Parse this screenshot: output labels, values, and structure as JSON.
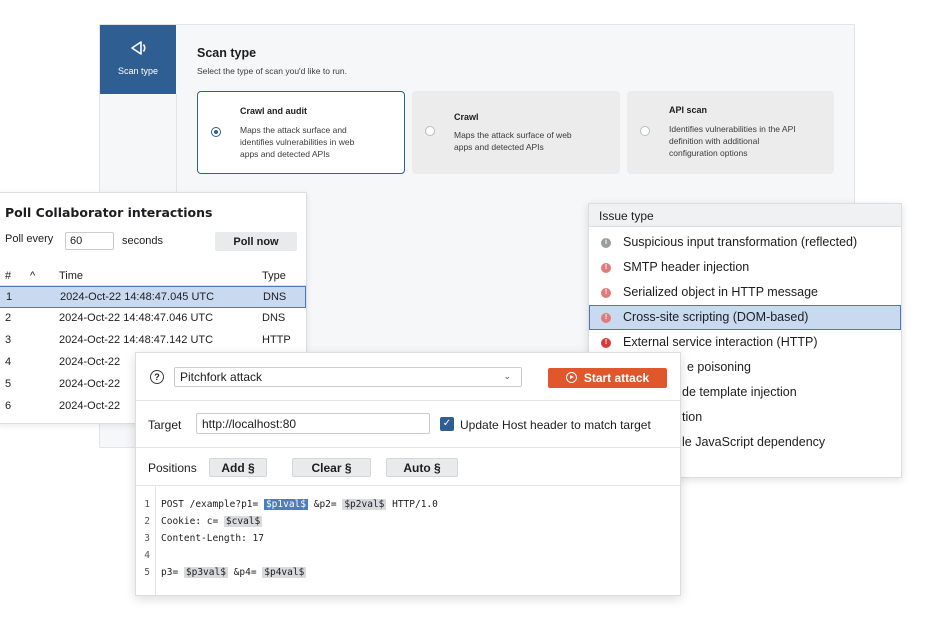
{
  "scan_panel": {
    "nav_label": "Scan type",
    "title": "Scan type",
    "subtitle": "Select the type of scan you'd like to run.",
    "options": [
      {
        "title": "Crawl and audit",
        "desc1": "Maps the attack surface and",
        "desc2": "identifies vulnerabilities in web",
        "desc3": "apps and detected APIs",
        "selected": true
      },
      {
        "title": "Crawl",
        "desc1": "Maps the attack surface of web",
        "desc2": "apps and detected APIs",
        "desc3": "",
        "selected": false
      },
      {
        "title": "API scan",
        "desc1": "Identifies vulnerabilities in the API",
        "desc2": "definition with additional",
        "desc3": "configuration options",
        "selected": false
      }
    ]
  },
  "poll": {
    "title": "Poll Collaborator interactions",
    "poll_every_label": "Poll every",
    "interval_value": "60",
    "seconds_label": "seconds",
    "poll_now_label": "Poll now",
    "headers": {
      "num": "#",
      "sort": "^",
      "time": "Time",
      "type": "Type"
    },
    "rows": [
      {
        "num": "1",
        "time": "2024-Oct-22 14:48:47.045 UTC",
        "type": "DNS"
      },
      {
        "num": "2",
        "time": "2024-Oct-22 14:48:47.046 UTC",
        "type": "DNS"
      },
      {
        "num": "3",
        "time": "2024-Oct-22 14:48:47.142 UTC",
        "type": "HTTP"
      },
      {
        "num": "4",
        "time": "2024-Oct-22",
        "type": ""
      },
      {
        "num": "5",
        "time": "2024-Oct-22",
        "type": ""
      },
      {
        "num": "6",
        "time": "2024-Oct-22",
        "type": ""
      }
    ]
  },
  "issues": {
    "header": "Issue type",
    "items": [
      {
        "label": "Suspicious input transformation (reflected)",
        "severity": "info",
        "color": "#9a9ca0",
        "glyph": "i"
      },
      {
        "label": "SMTP header injection",
        "severity": "high",
        "color": "#e07b7b",
        "glyph": "!"
      },
      {
        "label": "Serialized object in HTTP message",
        "severity": "high",
        "color": "#e07b7b",
        "glyph": "!"
      },
      {
        "label": "Cross-site scripting (DOM-based)",
        "severity": "high",
        "color": "#e07b7b",
        "glyph": "!"
      },
      {
        "label": "External service interaction (HTTP)",
        "severity": "high",
        "color": "#d83b3b",
        "glyph": "!"
      },
      {
        "label": "e poisoning",
        "severity": "",
        "color": "",
        "glyph": ""
      },
      {
        "label": "de template injection",
        "severity": "",
        "color": "",
        "glyph": ""
      },
      {
        "label": "tion",
        "severity": "",
        "color": "",
        "glyph": ""
      },
      {
        "label": "le JavaScript dependency",
        "severity": "",
        "color": "",
        "glyph": ""
      }
    ]
  },
  "intruder": {
    "help_glyph": "?",
    "attack_type": "Pitchfork attack",
    "start_label": "Start attack",
    "target_label": "Target",
    "target_value": "http://localhost:80",
    "update_host_label": "Update Host header to match target",
    "positions_label": "Positions",
    "add_label": "Add §",
    "clear_label": "Clear §",
    "auto_label": "Auto §",
    "code_lines": [
      {
        "n": "1",
        "parts": [
          [
            "t",
            "POST /example?p1= "
          ],
          [
            "m",
            "$p1val$"
          ],
          [
            "t",
            " &p2= "
          ],
          [
            "m",
            "$p2val$"
          ],
          [
            "t",
            " HTTP/1.0"
          ]
        ]
      },
      {
        "n": "2",
        "parts": [
          [
            "t",
            "Cookie: c= "
          ],
          [
            "m",
            "$cval$"
          ]
        ]
      },
      {
        "n": "3",
        "parts": [
          [
            "t",
            "Content-Length: 17"
          ]
        ]
      },
      {
        "n": "4",
        "parts": []
      },
      {
        "n": "5",
        "parts": [
          [
            "t",
            "p3= "
          ],
          [
            "m",
            "$p3val$"
          ],
          [
            "t",
            " &p4= "
          ],
          [
            "m",
            "$p4val$"
          ]
        ]
      }
    ]
  },
  "colors": {
    "accent_blue": "#2f5f92",
    "start_orange": "#e0572b",
    "selection": "#c9d9f0"
  }
}
